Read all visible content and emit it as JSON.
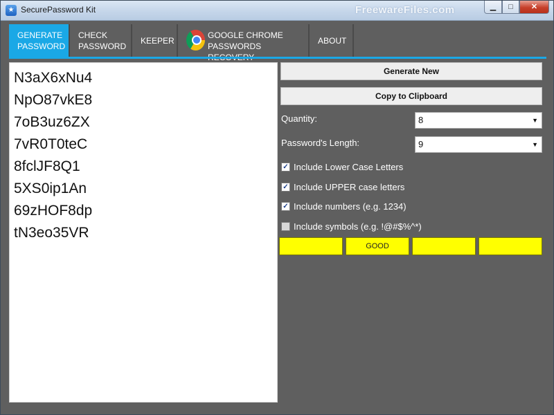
{
  "window": {
    "title": "SecurePassword Kit",
    "watermark": "FreewareFiles.com"
  },
  "window_buttons": {
    "minimize": "▁",
    "maximize": "□",
    "close": "✕"
  },
  "tabs": [
    {
      "line1": "GENERATE",
      "line2": "PASSWORD",
      "active": true
    },
    {
      "line1": "CHECK",
      "line2": "PASSWORD",
      "active": false
    },
    {
      "line1": "KEEPER",
      "line2": "",
      "active": false
    },
    {
      "line1": "GOOGLE CHROME",
      "line2": "PASSWORDS RECOVERY",
      "active": false,
      "icon": "chrome-icon"
    },
    {
      "line1": "ABOUT",
      "line2": "",
      "active": false
    }
  ],
  "passwords": [
    "N3aX6xNu4",
    "NpO87vkE8",
    "7oB3uz6ZX",
    "7vR0T0teC",
    "8fclJF8Q1",
    "5XS0ip1An",
    "69zHOF8dp",
    "tN3eo35VR"
  ],
  "actions": {
    "generate_new": "Generate New",
    "copy_clipboard": "Copy to Clipboard"
  },
  "settings": {
    "quantity_label": "Quantity:",
    "quantity_value": "8",
    "length_label": "Password's Length:",
    "length_value": "9"
  },
  "options": [
    {
      "label": "Include Lower Case Letters",
      "checked": true
    },
    {
      "label": "Include UPPER case letters",
      "checked": true
    },
    {
      "label": "Include numbers (e.g. 1234)",
      "checked": true
    },
    {
      "label": "Include symbols (e.g. !@#$%^*)",
      "checked": false
    }
  ],
  "strength": {
    "segments": [
      "",
      "GOOD",
      "",
      ""
    ],
    "color": "#ffff00"
  },
  "colors": {
    "accent": "#1aa8e6",
    "panel": "#5f5f5f"
  }
}
